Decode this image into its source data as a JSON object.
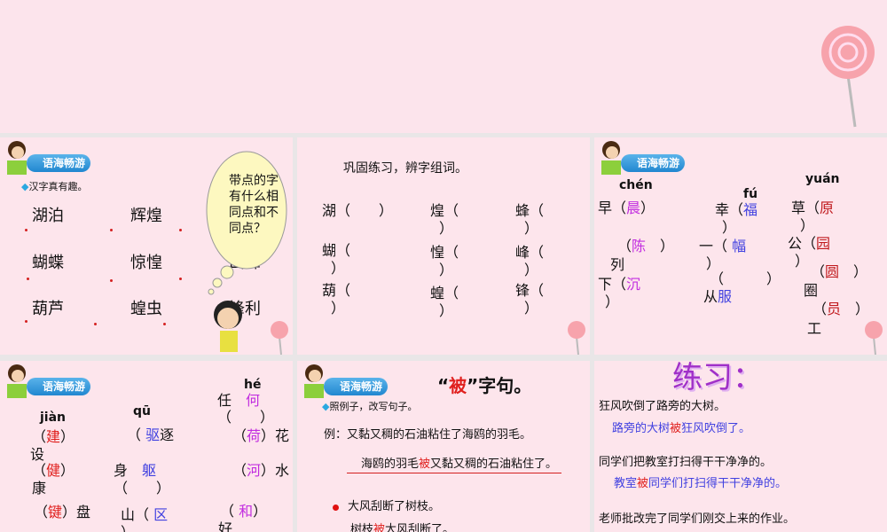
{
  "badge_label": "语海畅游",
  "p1": {
    "subtitle": "汉字真有趣。",
    "words": [
      "湖泊",
      "辉煌",
      "蝴蝶",
      "惊惶",
      "山峰",
      "葫芦",
      "蝗虫",
      "锋利"
    ],
    "bubble": "带点的字有什么相同点和不同点？"
  },
  "p2": {
    "title": "巩固练习，辨字组词。",
    "items": [
      "湖（　　）",
      "煌（",
      "）",
      "蜂（",
      "）",
      "蝴（",
      "）",
      "惶（",
      "）",
      "峰（",
      "）",
      "葫（",
      "）",
      "蝗（",
      "）",
      "锋（",
      "）"
    ]
  },
  "p3": {
    "pinyin": [
      "chén",
      "fú",
      "yuán"
    ],
    "col1": {
      "a": "早（",
      "a_ans": "晨",
      "a_end": "）",
      "b": "（",
      "b_ans": "陈",
      "b_end": "）",
      "b_word": "列",
      "c": "下（",
      "c_ans": "沉",
      "c_end": "）"
    },
    "col2": {
      "a": "幸（",
      "a_ans": "福",
      "a_end": "）",
      "b": "一（",
      "b_ans": "幅",
      "b_end": "）",
      "c": "（　　　）",
      "c_word": "从",
      "c_ans": "服"
    },
    "col3": {
      "a": "草（",
      "a_ans": "原",
      "a_end": "）",
      "b": "公（",
      "b_ans": "园",
      "b_end": "）",
      "c": "（",
      "c_ans": "圆",
      "c_end": "）",
      "c_word": "圈",
      "d": "（",
      "d_ans": "员",
      "d_end": "）",
      "d_word": "工"
    }
  },
  "p4": {
    "pinyin": [
      "jiàn",
      "qū",
      "hé"
    ],
    "c1": [
      {
        "o": "（",
        "a": "建",
        "c": "）",
        "w": "设"
      },
      {
        "o": "（",
        "a": "健",
        "c": "）",
        "w": "康"
      },
      {
        "o": "（",
        "a": "键",
        "c": "）盘"
      }
    ],
    "c2": [
      {
        "o": "（",
        "a": "驱",
        "c": "逐"
      },
      {
        "pre": "身",
        "a": "躯",
        "post": "（　　）"
      },
      {
        "pre": "山（",
        "a": "区",
        "post": "）"
      }
    ],
    "c3": [
      {
        "pre": "任",
        "a": "何",
        "post": "（　　）"
      },
      {
        "o": "（",
        "a": "荷",
        "c": "）花"
      },
      {
        "o": "（",
        "a": "河",
        "c": "）水"
      },
      {
        "o": "（",
        "a": "和",
        "c": "）",
        "w": "好"
      }
    ]
  },
  "p5": {
    "title_open": "“",
    "title_bei": "被",
    "title_rest": "”字句。",
    "subtitle": "照例子，改写句子。",
    "example": "例：又黏又稠的石油粘住了海鸥的羽毛。",
    "answer_a": "海鸥的羽毛",
    "bei": "被",
    "answer_b": "又黏又稠的石油粘住了。",
    "q1": "大风刮断了树枝。",
    "a1_a": "树枝",
    "a1_b": "大风刮断了。"
  },
  "p6": {
    "title": "练习：",
    "q1": "狂风吹倒了路旁的大树。",
    "a1_a": "路旁的大树",
    "bei": "被",
    "a1_b": "狂风吹倒了。",
    "q2": "同学们把教室打扫得干干净净的。",
    "a2_a": "教室",
    "a2_b": "同学们打扫得干干净净的。",
    "q3": "老师批改完了同学们刚交上来的作业。"
  }
}
